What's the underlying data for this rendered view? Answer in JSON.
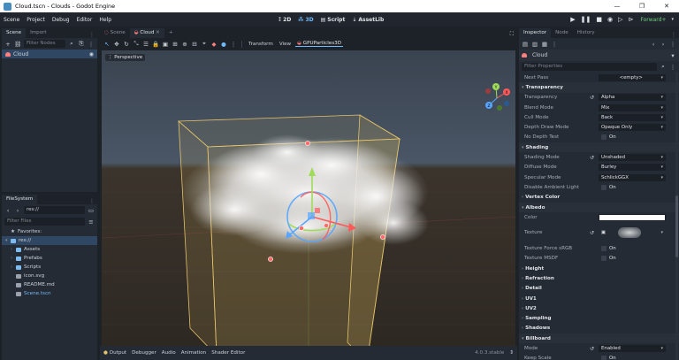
{
  "window": {
    "title": "Cloud.tscn - Clouds - Godot Engine"
  },
  "menubar": {
    "menus": [
      "Scene",
      "Project",
      "Debug",
      "Editor",
      "Help"
    ],
    "workspaces": [
      "2D",
      "3D",
      "Script",
      "AssetLib"
    ],
    "active_workspace": "3D",
    "renderer": "Forward+"
  },
  "scene_dock": {
    "tabs": [
      "Scene",
      "Import"
    ],
    "filter_placeholder": "Filter Nodes",
    "root_node": "Cloud"
  },
  "filesystem": {
    "tab": "FileSystem",
    "path": "res://",
    "filter_placeholder": "Filter Files",
    "items": [
      {
        "label": "Favorites:",
        "kind": "favorites",
        "depth": 0
      },
      {
        "label": "res://",
        "kind": "folder",
        "depth": 0,
        "selected": true
      },
      {
        "label": "Assets",
        "kind": "folder",
        "depth": 1
      },
      {
        "label": "Prefabs",
        "kind": "folder",
        "depth": 1
      },
      {
        "label": "Scripts",
        "kind": "folder",
        "depth": 1
      },
      {
        "label": "icon.svg",
        "kind": "file",
        "depth": 1
      },
      {
        "label": "README.md",
        "kind": "file",
        "depth": 1
      },
      {
        "label": "Scene.tscn",
        "kind": "file",
        "depth": 1
      }
    ]
  },
  "editor_tabs": {
    "tabs": [
      "Scene",
      "Cloud"
    ],
    "active": "Cloud"
  },
  "viewport": {
    "menus": [
      "Transform",
      "View"
    ],
    "node_button": "GPUParticles3D",
    "perspective_label": "Perspective"
  },
  "bottom_panel": {
    "tabs": [
      "Output",
      "Debugger",
      "Audio",
      "Animation",
      "Shader Editor"
    ],
    "version": "4.0.3.stable"
  },
  "inspector": {
    "tabs": [
      "Inspector",
      "Node",
      "History"
    ],
    "object_name": "Cloud",
    "filter_placeholder": "Filter Properties",
    "rows": [
      {
        "type": "prop",
        "label": "Next Pass",
        "value": "<empty>",
        "dropdown": true
      },
      {
        "type": "section",
        "label": "Transparency",
        "open": true
      },
      {
        "type": "prop",
        "label": "Transparency",
        "value": "Alpha",
        "dropdown": true,
        "revert": true
      },
      {
        "type": "prop",
        "label": "Blend Mode",
        "value": "Mix",
        "dropdown": true
      },
      {
        "type": "prop",
        "label": "Cull Mode",
        "value": "Back",
        "dropdown": true
      },
      {
        "type": "prop",
        "label": "Depth Draw Mode",
        "value": "Opaque Only",
        "dropdown": true
      },
      {
        "type": "check",
        "label": "No Depth Test",
        "value": "On"
      },
      {
        "type": "section",
        "label": "Shading",
        "open": true
      },
      {
        "type": "prop",
        "label": "Shading Mode",
        "value": "Unshaded",
        "dropdown": true,
        "revert": true
      },
      {
        "type": "prop",
        "label": "Diffuse Mode",
        "value": "Burley",
        "dropdown": true
      },
      {
        "type": "prop",
        "label": "Specular Mode",
        "value": "SchlickGGX",
        "dropdown": true
      },
      {
        "type": "check",
        "label": "Disable Ambient Light",
        "value": "On"
      },
      {
        "type": "section",
        "label": "Vertex Color",
        "open": false
      },
      {
        "type": "section",
        "label": "Albedo",
        "open": true
      },
      {
        "type": "color",
        "label": "Color",
        "value": "#ffffff"
      },
      {
        "type": "texture",
        "label": "Texture",
        "revert": true
      },
      {
        "type": "check",
        "label": "Texture Force sRGB",
        "value": "On"
      },
      {
        "type": "check",
        "label": "Texture MSDF",
        "value": "On"
      },
      {
        "type": "section",
        "label": "Height",
        "open": false
      },
      {
        "type": "section",
        "label": "Refraction",
        "open": false
      },
      {
        "type": "section",
        "label": "Detail",
        "open": false
      },
      {
        "type": "section",
        "label": "UV1",
        "open": false
      },
      {
        "type": "section",
        "label": "UV2",
        "open": false
      },
      {
        "type": "section",
        "label": "Sampling",
        "open": false
      },
      {
        "type": "section",
        "label": "Shadows",
        "open": false
      },
      {
        "type": "section",
        "label": "Billboard",
        "open": true
      },
      {
        "type": "prop",
        "label": "Mode",
        "value": "Enabled",
        "dropdown": true,
        "revert": true
      },
      {
        "type": "check",
        "label": "Keep Scale",
        "value": "On"
      }
    ]
  },
  "colors": {
    "accent": "#70bafa",
    "node_3d": "#fc7f7f",
    "bounds_box": "#e3c36a"
  },
  "icons": {
    "window": [
      "minimize-icon",
      "maximize-icon",
      "close-icon"
    ],
    "playback": [
      "play-icon",
      "pause-icon",
      "stop-icon",
      "movie-icon",
      "play-scene-icon",
      "play-custom-icon"
    ]
  }
}
